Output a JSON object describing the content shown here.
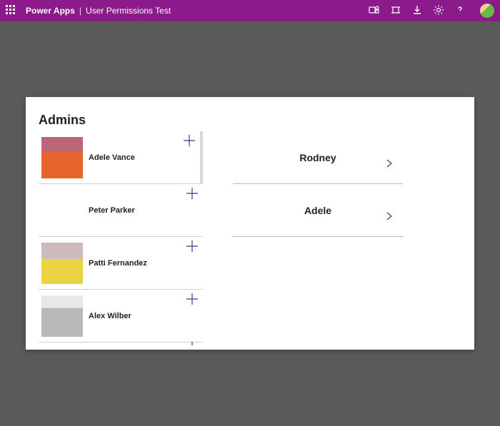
{
  "topbar": {
    "brand": "Power Apps",
    "divider": "|",
    "title": "User Permissions Test"
  },
  "heading": "Admins",
  "admins": [
    {
      "name": "Adele Vance"
    },
    {
      "name": "Peter Parker"
    },
    {
      "name": "Patti Fernandez"
    },
    {
      "name": "Alex Wilber"
    }
  ],
  "details": [
    {
      "name": "Rodney"
    },
    {
      "name": "Adele"
    }
  ]
}
